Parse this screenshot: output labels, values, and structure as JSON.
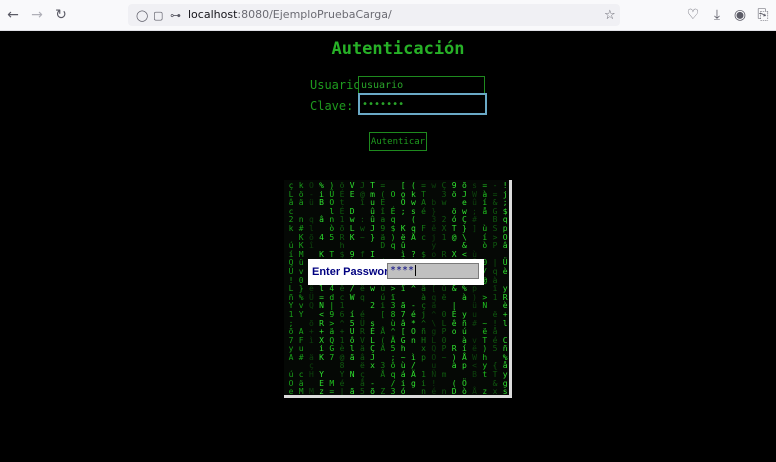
{
  "browser": {
    "url_host": "localhost",
    "url_rest": ":8080/EjemploPruebaCarga/"
  },
  "page": {
    "title": "Autenticación",
    "user_label": "Usuario:",
    "user_value": "usuario",
    "password_label": "Clave:",
    "password_value": "•••••••",
    "submit_label": "Autenticar"
  },
  "image": {
    "prompt_label": "Enter Password:",
    "prompt_value": "****"
  },
  "colors": {
    "accent": "#27b127",
    "prompt_text": "#000080"
  }
}
